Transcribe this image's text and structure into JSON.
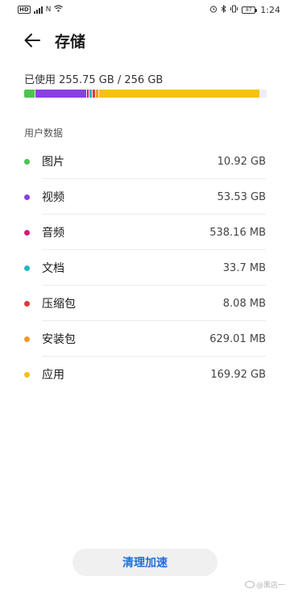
{
  "status_bar": {
    "time": "1:24",
    "battery": "87",
    "left_icons": [
      "hd-icon",
      "signal-icon",
      "nfc-icon",
      "wifi-icon"
    ],
    "right_icons": [
      "alarm-icon",
      "bluetooth-icon",
      "vibrate-icon",
      "battery-icon"
    ]
  },
  "header": {
    "title": "存储"
  },
  "usage": {
    "text": "已使用 255.75 GB / 256 GB",
    "used_gb": 255.75,
    "total_gb": 256,
    "segments": [
      {
        "name": "图片",
        "gb": 10.92,
        "color": "#4cc34f"
      },
      {
        "name": "视频",
        "gb": 53.53,
        "color": "#8a3fe0"
      },
      {
        "name": "音频",
        "gb": 0.538,
        "color": "#d81b7a"
      },
      {
        "name": "文档",
        "gb": 0.034,
        "color": "#1fb8c8"
      },
      {
        "name": "压缩包",
        "gb": 0.008,
        "color": "#e03a3a"
      },
      {
        "name": "安装包",
        "gb": 0.629,
        "color": "#f39a1c"
      },
      {
        "name": "应用",
        "gb": 169.92,
        "color": "#f5c113"
      }
    ]
  },
  "section_label": "用户数据",
  "items": [
    {
      "label": "图片",
      "size": "10.92 GB",
      "color": "#4cc34f"
    },
    {
      "label": "视频",
      "size": "53.53 GB",
      "color": "#8a3fe0"
    },
    {
      "label": "音频",
      "size": "538.16 MB",
      "color": "#d81b7a"
    },
    {
      "label": "文档",
      "size": "33.7 MB",
      "color": "#1fb8c8"
    },
    {
      "label": "压缩包",
      "size": "8.08 MB",
      "color": "#e03a3a"
    },
    {
      "label": "安装包",
      "size": "629.01 MB",
      "color": "#f39a1c"
    },
    {
      "label": "应用",
      "size": "169.92 GB",
      "color": "#f5c113"
    }
  ],
  "clean_button_label": "清理加速",
  "watermark": "@黑店一"
}
